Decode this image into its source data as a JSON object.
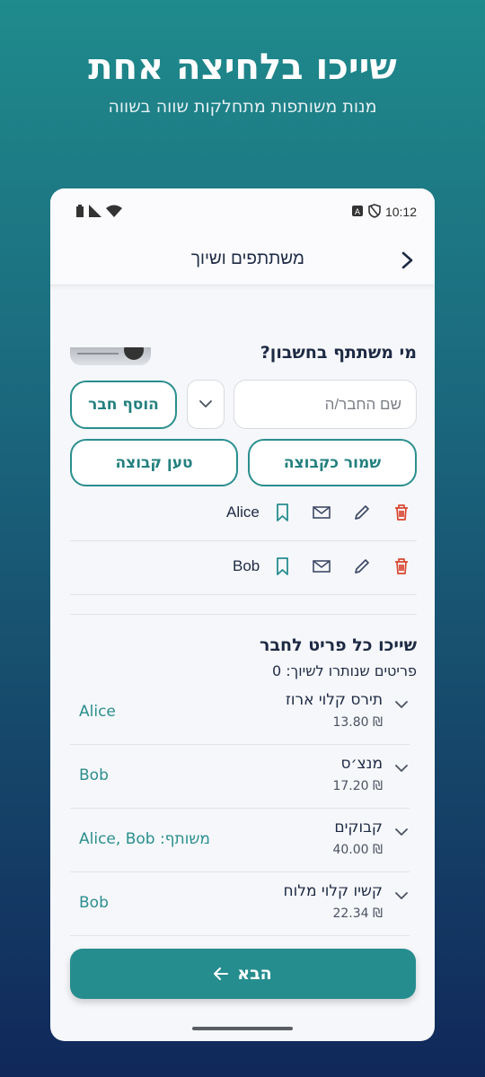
{
  "promo": {
    "title": "שייכו בלחיצה אחת",
    "subtitle": "מנות משותפות מתחלקות שווה בשווה"
  },
  "status_bar": {
    "time": "10:12",
    "icons": [
      "shield-icon",
      "a-badge-icon",
      "wifi-icon",
      "signal-icon",
      "battery-icon"
    ]
  },
  "app_bar": {
    "title": "משתתפים ושיוך",
    "back_icon": "chevron-right-icon"
  },
  "participants": {
    "title": "מי משתתף בחשבון?",
    "input_placeholder": "שם החבר/ה",
    "add_button": "הוסף חבר",
    "save_group_button": "שמור כקבוצה",
    "load_group_button": "טען קבוצה",
    "members": [
      {
        "name": "Alice"
      },
      {
        "name": "Bob"
      }
    ],
    "row_icons": [
      "bookmark-icon",
      "mail-icon",
      "edit-icon",
      "delete-icon"
    ]
  },
  "assignment": {
    "title": "שייכו כל פריט לחבר",
    "remaining": "פריטים שנותרו לשיוך: 0",
    "items": [
      {
        "name": "תירס קלוי ארוז",
        "price": "₪ 13.80",
        "assignee": "Alice"
      },
      {
        "name": "מנצ׳ס",
        "price": "₪ 17.20",
        "assignee": "Bob"
      },
      {
        "name": "קבוקים",
        "price": "₪ 40.00",
        "assignee": "משותף: Alice, Bob"
      },
      {
        "name": "קשיו קלוי מלוח",
        "price": "₪ 22.34",
        "assignee": "Bob"
      }
    ]
  },
  "next_button": "הבא",
  "colors": {
    "accent": "#268d8f",
    "delete": "#d9452f",
    "text": "#1d2a44"
  }
}
